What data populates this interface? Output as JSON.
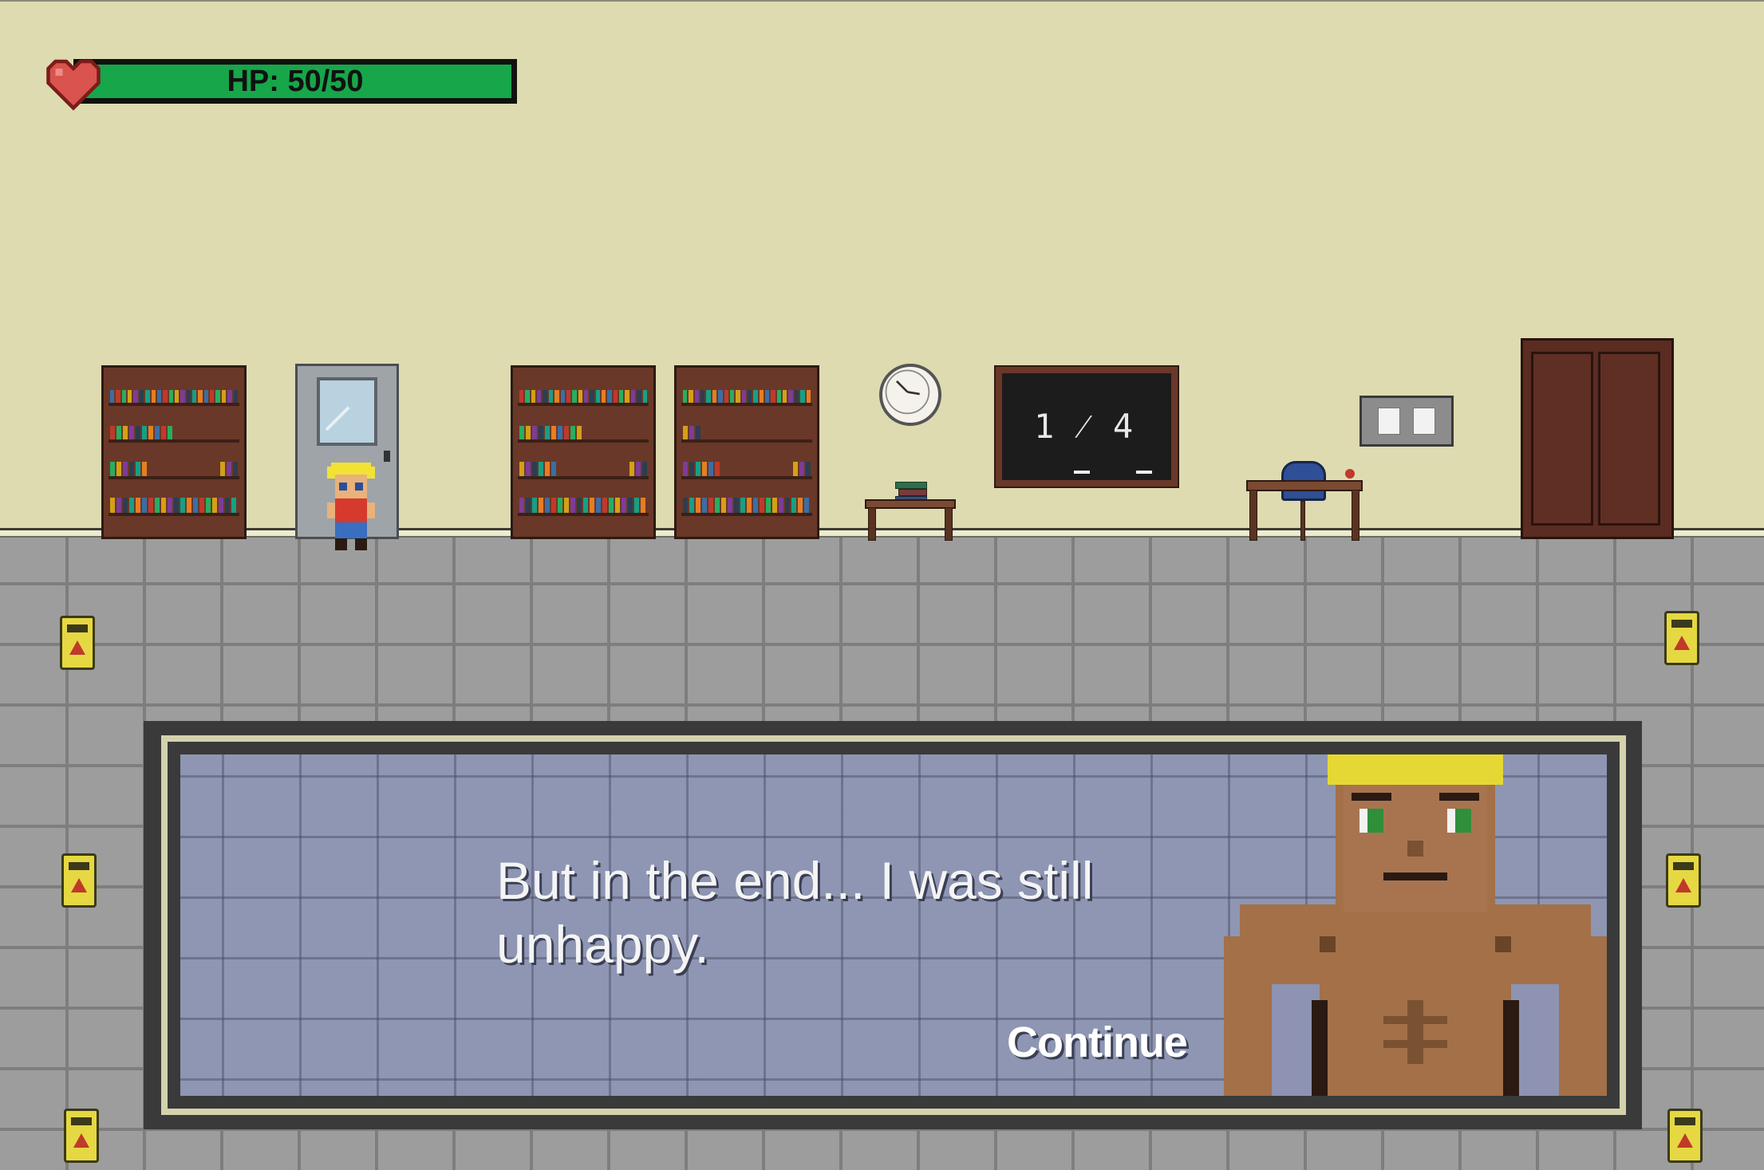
{
  "hud": {
    "hp_text": "HP: 50/50",
    "hp_current": 50,
    "hp_max": 50,
    "bar_color": "#17a64a",
    "heart_color": "#d9534f"
  },
  "scene": {
    "chalkboard_text": "1 ⁄ 4",
    "wall_color": "#dedbb1",
    "floor_color": "#9d9d9d"
  },
  "dialogue": {
    "text": "But in the end... I was still unhappy.",
    "continue_label": "Continue",
    "panel_color": "#8e96b3"
  },
  "icons": {
    "heart": "heart-icon",
    "wet_floor_sign": "wet-floor-sign-icon"
  }
}
